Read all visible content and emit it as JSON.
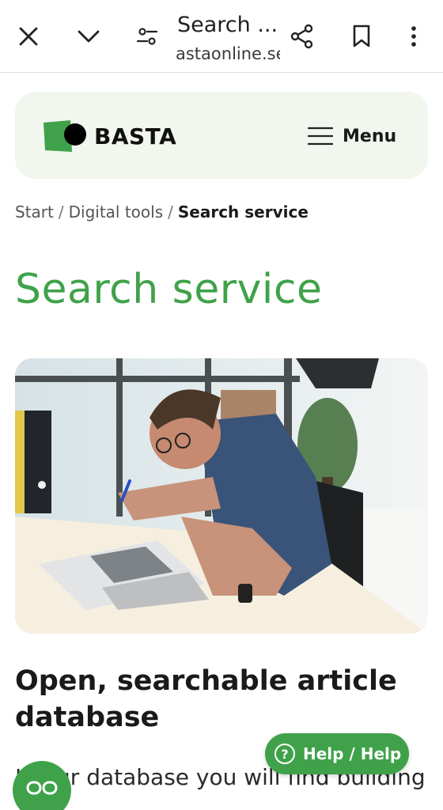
{
  "browser": {
    "title": "Search ...",
    "url": "astaonline.se"
  },
  "header": {
    "logo_text": "BASTA",
    "menu_label": "Menu"
  },
  "breadcrumb": {
    "items": [
      "Start",
      "Digital tools"
    ],
    "separator": "/",
    "current": "Search service"
  },
  "page": {
    "title": "Search service",
    "section_title": "Open, searchable article database",
    "intro": "In our database you will find building"
  },
  "help": {
    "label": "Help / Help",
    "icon": "question-circle-icon"
  },
  "colors": {
    "brand_green": "#3fa24a",
    "header_bg": "#f1f6ee"
  }
}
